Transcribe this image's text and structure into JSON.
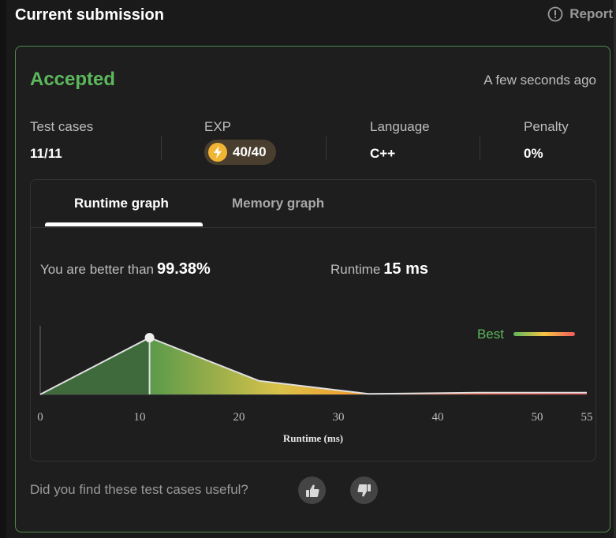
{
  "header": {
    "title": "Current submission",
    "report_label": "Report"
  },
  "submission": {
    "status": "Accepted",
    "time_ago": "A few seconds ago",
    "stats": [
      {
        "label": "Test cases",
        "value": "11/11"
      },
      {
        "label": "EXP",
        "value": "40/40"
      },
      {
        "label": "Language",
        "value": "C++"
      },
      {
        "label": "Penalty",
        "value": "0%"
      }
    ]
  },
  "graph": {
    "tabs": [
      {
        "label": "Runtime graph",
        "active": true
      },
      {
        "label": "Memory graph",
        "active": false
      }
    ],
    "better_than_label": "You are better than",
    "better_than_value": "99.38%",
    "runtime_label": "Runtime",
    "runtime_value": "15 ms",
    "legend_label": "Best"
  },
  "colors": {
    "accent_green": "#5cb85c",
    "card_border": "#4f8a4a",
    "exp_pill": "#4a3f2e"
  },
  "chart_data": {
    "type": "area",
    "xlabel": "Runtime (ms)",
    "ylabel": "",
    "x_ticks": [
      0,
      10,
      20,
      30,
      40,
      50,
      55
    ],
    "xlim": [
      0,
      55
    ],
    "x": [
      0,
      11,
      22,
      33,
      44,
      55
    ],
    "y": [
      0,
      1.0,
      0.24,
      0.01,
      0.03,
      0.03
    ],
    "marker": {
      "x": 11,
      "y": 1.0
    },
    "legend": [
      {
        "name": "Best",
        "gradient": [
          "#5cb85c",
          "#f5c542",
          "#f05a5a"
        ]
      }
    ]
  },
  "feedback": {
    "question": "Did you find these test cases useful?"
  }
}
